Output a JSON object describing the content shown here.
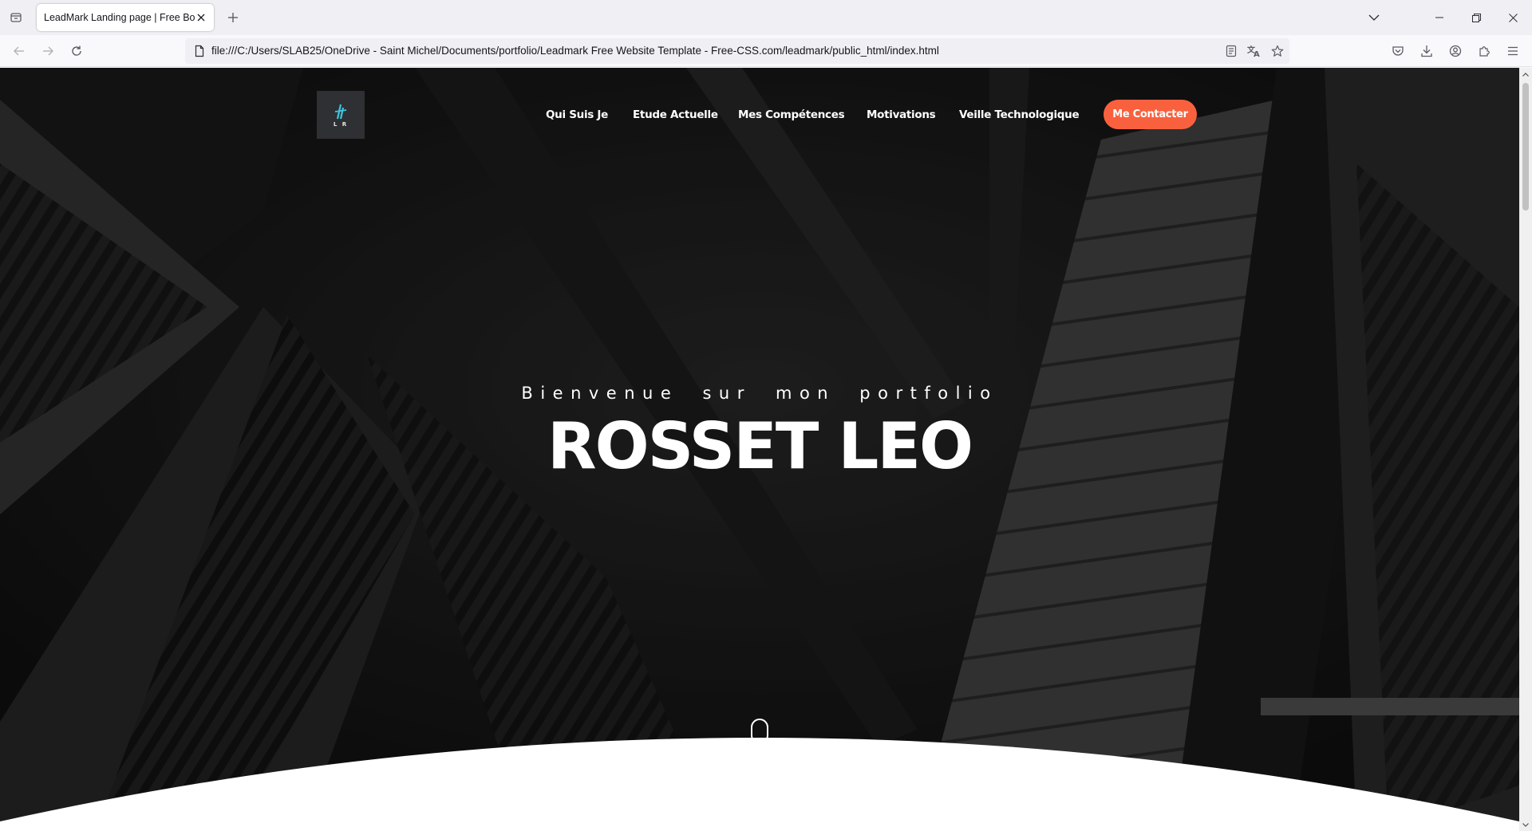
{
  "browser": {
    "tab_title": "LeadMark Landing page | Free Boot",
    "url": "file:///C:/Users/SLAB25/OneDrive - Saint Michel/Documents/portfolio/Leadmark Free Website Template - Free-CSS.com/leadmark/public_html/index.html",
    "icons": {
      "tab_list": "tab-list-icon",
      "close_tab": "close-icon",
      "new_tab": "plus-icon",
      "back": "arrow-left-icon",
      "forward": "arrow-right-icon",
      "reload": "reload-icon",
      "page": "page-icon",
      "reader_view": "reader-view-icon",
      "translate": "translate-icon",
      "bookmark": "star-icon",
      "pocket": "pocket-icon",
      "downloads": "download-icon",
      "account": "account-icon",
      "extensions": "puzzle-icon",
      "menu": "hamburger-icon"
    }
  },
  "site": {
    "logo_initials": "L R",
    "nav": [
      {
        "label": "Qui Suis Je"
      },
      {
        "label": "Etude Actuelle"
      },
      {
        "label": "Mes Compétences"
      },
      {
        "label": "Motivations"
      },
      {
        "label": "Veille Technologique"
      }
    ],
    "contact_label": "Me Contacter",
    "hero": {
      "subtitle": "Bienvenue sur mon portfolio",
      "title": "ROSSET LEO"
    }
  },
  "colors": {
    "accent": "#f9613e",
    "logo_mark": "#3ec6e0",
    "hero_bg": "#161616",
    "text_light": "#ffffff"
  }
}
